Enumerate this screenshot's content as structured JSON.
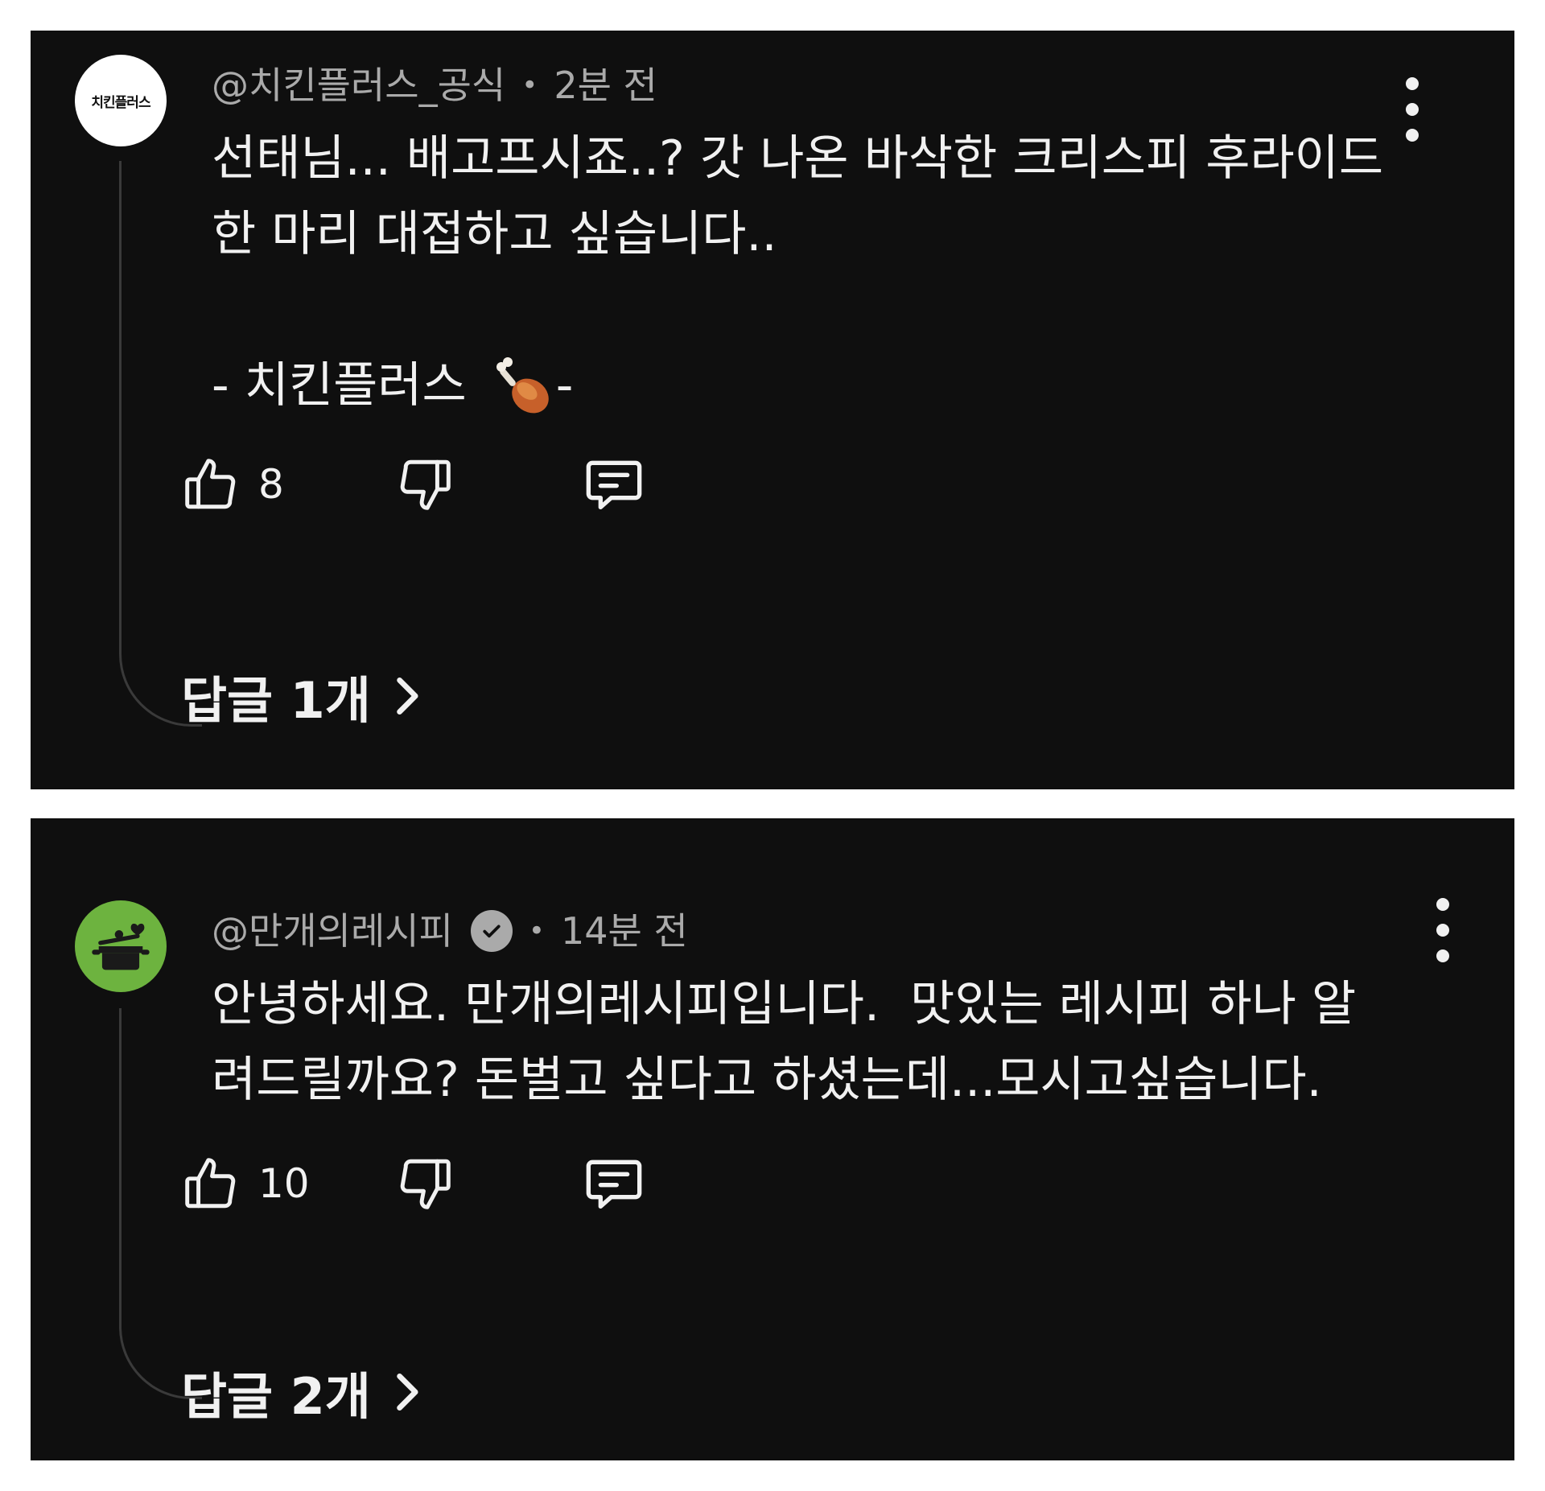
{
  "comments": [
    {
      "handle": "@치킨플러스_공식",
      "time": "2분 전",
      "avatar_text": "치킨플러스",
      "text": "선태님... 배고프시죠..? 갓 나온 바삭한 크리스피 후라이드\n한 마리 대접하고 싶습니다..\n\n- 치킨플러스 ",
      "text_suffix": "-",
      "text_emoji": "poultry-leg-emoji",
      "likes": "8",
      "replies": "답글 1개",
      "verified": false
    },
    {
      "handle": "@만개의레시피",
      "time": "14분 전",
      "avatar_icon": "cooking-pot-icon",
      "text": "안녕하세요. 만개의레시피입니다.  맛있는 레시피 하나 알\n려드릴까요? 돈벌고 싶다고 하셨는데...모시고싶습니다.",
      "likes": "10",
      "replies": "답글 2개",
      "verified": true
    }
  ],
  "colors": {
    "background": "#0f0f0f",
    "text": "#f1f1f1",
    "meta": "#aaaaaa",
    "avatar_green": "#6db33f",
    "thread_line": "#3a3a3a"
  }
}
